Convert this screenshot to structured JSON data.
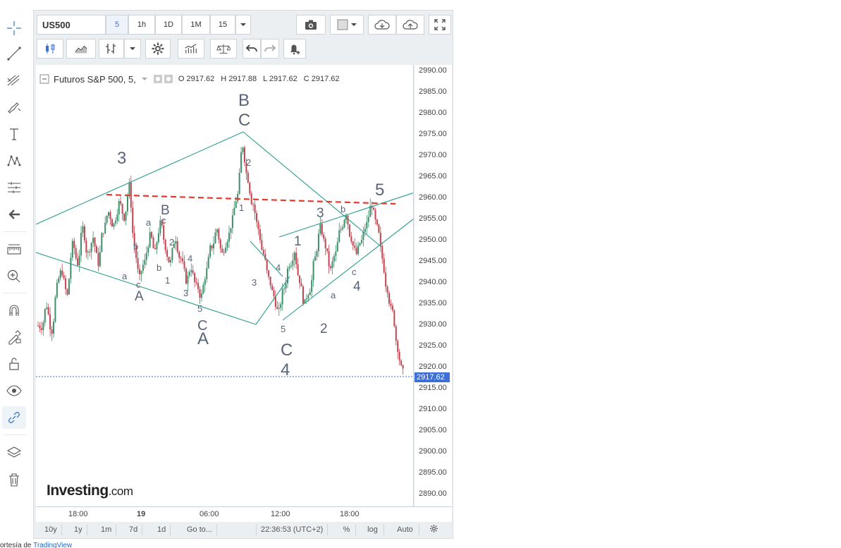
{
  "toolbar": {
    "symbol": "US500",
    "intervals": [
      "5",
      "1h",
      "1D",
      "1M",
      "15"
    ]
  },
  "legend": {
    "title": "Futuros S&P 500, 5,",
    "o_label": "O",
    "o": "2917.62",
    "h_label": "H",
    "h": "2917.88",
    "l_label": "L",
    "l": "2917.62",
    "c_label": "C",
    "c": "2917.62"
  },
  "price_axis": {
    "labels": [
      "2990.00",
      "2985.00",
      "2980.00",
      "2975.00",
      "2970.00",
      "2965.00",
      "2960.00",
      "2955.00",
      "2950.00",
      "2945.00",
      "2940.00",
      "2935.00",
      "2930.00",
      "2925.00",
      "2920.00",
      "2915.00",
      "2910.00",
      "2905.00",
      "2900.00",
      "2895.00",
      "2890.00"
    ],
    "current": "2917.62"
  },
  "time_axis": {
    "labels": [
      "18:00",
      "19",
      "06:00",
      "12:00",
      "18:00"
    ]
  },
  "bottom_bar": {
    "ranges": [
      "10y",
      "1y",
      "1m",
      "7d",
      "1d"
    ],
    "goto": "Go to...",
    "time": "22:36:53 (UTC+2)",
    "percent": "%",
    "log": "log",
    "auto": "Auto"
  },
  "wave_labels": {
    "big": [
      "3",
      "B",
      "C",
      "A",
      "B",
      "C",
      "A",
      "C",
      "4",
      "3",
      "1",
      "2",
      "4",
      "5"
    ],
    "small": [
      "a",
      "b",
      "c",
      "b",
      "a",
      "c",
      "2",
      "4",
      "1",
      "3",
      "5",
      "2",
      "1",
      "4",
      "3",
      "5",
      "a",
      "b",
      "c",
      "A",
      "B"
    ]
  },
  "logo": {
    "brand": "Investing",
    "suffix": ".com"
  },
  "credit": {
    "prefix": "ortesía de ",
    "link": "TradingView"
  },
  "colors": {
    "up": "#3e8e6a",
    "down": "#c1444e",
    "trendline": "#2a9d8f",
    "dashed": "#e23b2e",
    "current_price": "#3d6fd6"
  },
  "chart_data": {
    "type": "candlestick",
    "symbol": "Futuros S&P 500",
    "interval": "5",
    "ylim": [
      2886,
      2991
    ],
    "last": 2917.62,
    "series": [
      {
        "values": [
          2929,
          2934,
          2928,
          2938,
          2942,
          2936,
          2948,
          2944,
          2952,
          2946,
          2950,
          2944,
          2952,
          2956,
          2953,
          2958,
          2955,
          2962,
          2948,
          2940,
          2944,
          2950,
          2946,
          2953,
          2948,
          2944,
          2950,
          2945,
          2940,
          2943,
          2938,
          2936,
          2942,
          2948,
          2952,
          2946,
          2950,
          2954,
          2960,
          2972,
          2964,
          2958,
          2952,
          2946,
          2940,
          2936,
          2932,
          2938,
          2944,
          2947,
          2940,
          2934,
          2938,
          2945,
          2952,
          2948,
          2942,
          2946,
          2952,
          2956,
          2950,
          2946,
          2949,
          2953,
          2958,
          2952,
          2945,
          2938,
          2932,
          2924,
          2917.62
        ]
      }
    ]
  }
}
